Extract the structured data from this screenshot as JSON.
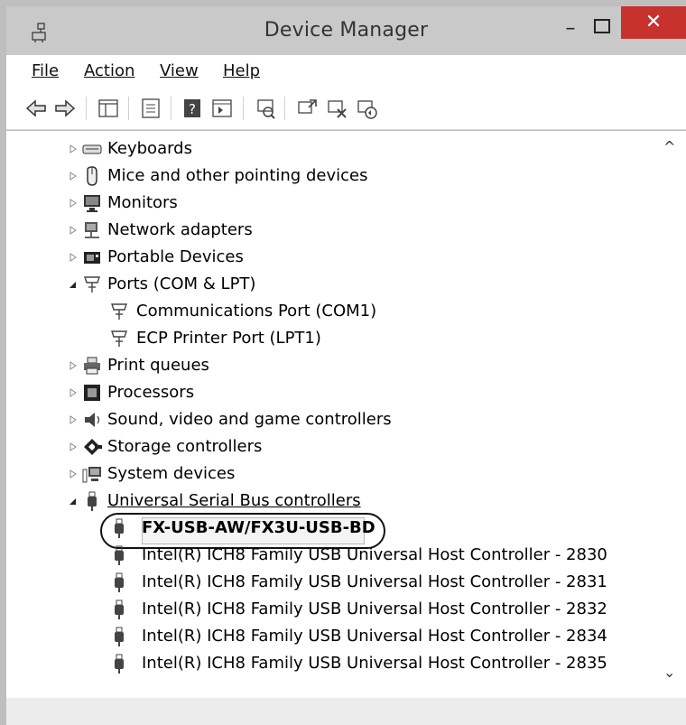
{
  "window": {
    "title": "Device Manager",
    "close_symbol": "✕",
    "min_symbol": "–"
  },
  "menu": [
    "File",
    "Action",
    "View",
    "Help"
  ],
  "toolbar_icons": [
    "back-icon",
    "forward-icon",
    "show-hide-console-tree-icon",
    "properties-icon",
    "help-icon",
    "show-action-pane-icon",
    "scan-hardware-icon",
    "update-driver-icon",
    "uninstall-icon",
    "disable-icon"
  ],
  "tree": [
    {
      "label": "Keyboards",
      "icon": "keyboard-icon",
      "state": "collapsed"
    },
    {
      "label": "Mice and other pointing devices",
      "icon": "mouse-icon",
      "state": "collapsed"
    },
    {
      "label": "Monitors",
      "icon": "monitor-icon",
      "state": "collapsed"
    },
    {
      "label": "Network adapters",
      "icon": "network-adapter-icon",
      "state": "collapsed"
    },
    {
      "label": "Portable Devices",
      "icon": "portable-device-icon",
      "state": "collapsed"
    },
    {
      "label": "Ports (COM & LPT)",
      "icon": "port-icon",
      "state": "expanded"
    },
    {
      "label": "Communications Port (COM1)",
      "icon": "port-icon",
      "state": "leaf"
    },
    {
      "label": "ECP Printer Port (LPT1)",
      "icon": "port-icon",
      "state": "leaf"
    },
    {
      "label": "Print queues",
      "icon": "printer-icon",
      "state": "collapsed"
    },
    {
      "label": "Processors",
      "icon": "processor-icon",
      "state": "collapsed"
    },
    {
      "label": "Sound, video and game controllers",
      "icon": "speaker-icon",
      "state": "collapsed"
    },
    {
      "label": "Storage controllers",
      "icon": "storage-icon",
      "state": "collapsed"
    },
    {
      "label": "System devices",
      "icon": "system-device-icon",
      "state": "collapsed"
    },
    {
      "label": "Universal Serial Bus controllers",
      "icon": "usb-icon",
      "state": "expanded"
    },
    {
      "label": "FX-USB-AW/FX3U-USB-BD",
      "icon": "usb-icon",
      "state": "leaf-selected"
    },
    {
      "label": "Intel(R) ICH8 Family USB Universal Host Controller - 2830",
      "icon": "usb-icon",
      "state": "leaf"
    },
    {
      "label": "Intel(R) ICH8 Family USB Universal Host Controller - 2831",
      "icon": "usb-icon",
      "state": "leaf"
    },
    {
      "label": "Intel(R) ICH8 Family USB Universal Host Controller - 2832",
      "icon": "usb-icon",
      "state": "leaf"
    },
    {
      "label": "Intel(R) ICH8 Family USB Universal Host Controller - 2834",
      "icon": "usb-icon",
      "state": "leaf"
    },
    {
      "label": "Intel(R) ICH8 Family USB Universal Host Controller - 2835",
      "icon": "usb-icon",
      "state": "leaf"
    }
  ],
  "scroll": {
    "up": "^",
    "down": "⌄"
  },
  "colors": {
    "close_button": "#c7312e",
    "titlebar": "#c9c9c9",
    "highlight_border": "#111111"
  }
}
